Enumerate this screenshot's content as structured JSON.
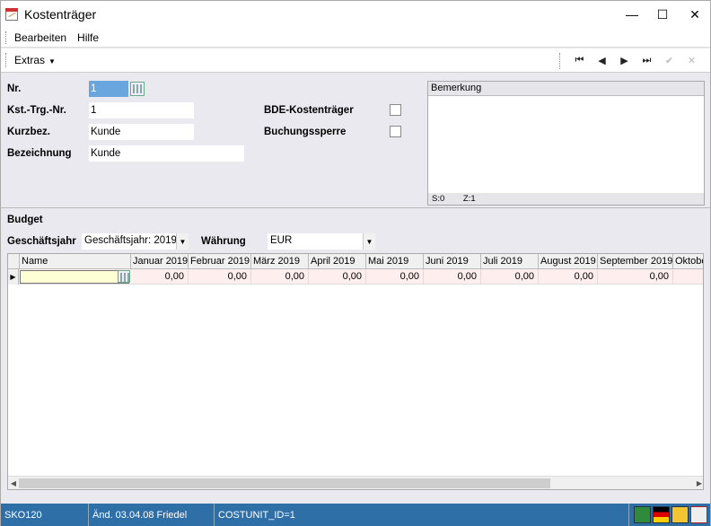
{
  "window": {
    "title": "Kostenträger",
    "minimize": "—",
    "maximize": "☐",
    "close": "✕"
  },
  "menu": {
    "items": [
      "Bearbeiten",
      "Hilfe"
    ]
  },
  "toolbar": {
    "extras_label": "Extras",
    "nav": [
      "⏮",
      "◀",
      "▶",
      "⏭",
      "✔",
      "✕"
    ]
  },
  "form": {
    "nr_label": "Nr.",
    "nr_value": "1",
    "kst_label": "Kst.-Trg.-Nr.",
    "kst_value": "1",
    "kurzbez_label": "Kurzbez.",
    "kurzbez_value": "Kunde",
    "bezeichnung_label": "Bezeichnung",
    "bezeichnung_value": "Kunde",
    "bde_label": "BDE-Kostenträger",
    "buchungssperre_label": "Buchungssperre",
    "bemerkung_label": "Bemerkung",
    "memo_s": "S:0",
    "memo_z": "Z:1"
  },
  "budget": {
    "section_label": "Budget",
    "geschaeftsjahr_label": "Geschäftsjahr",
    "geschaeftsjahr_value": "Geschäftsjahr: 2019",
    "waehrung_label": "Währung",
    "waehrung_value": "EUR"
  },
  "grid": {
    "name_header": "Name",
    "months": [
      "Januar 2019",
      "Februar 2019",
      "März 2019",
      "April 2019",
      "Mai 2019",
      "Juni 2019",
      "Juli 2019",
      "August 2019",
      "September 2019",
      "Oktober"
    ],
    "row_values": [
      "0,00",
      "0,00",
      "0,00",
      "0,00",
      "0,00",
      "0,00",
      "0,00",
      "0,00",
      "0,00",
      ""
    ]
  },
  "status": {
    "module": "SKO120",
    "changed": "Änd. 03.04.08 Friedel",
    "id": "COSTUNIT_ID=1"
  }
}
